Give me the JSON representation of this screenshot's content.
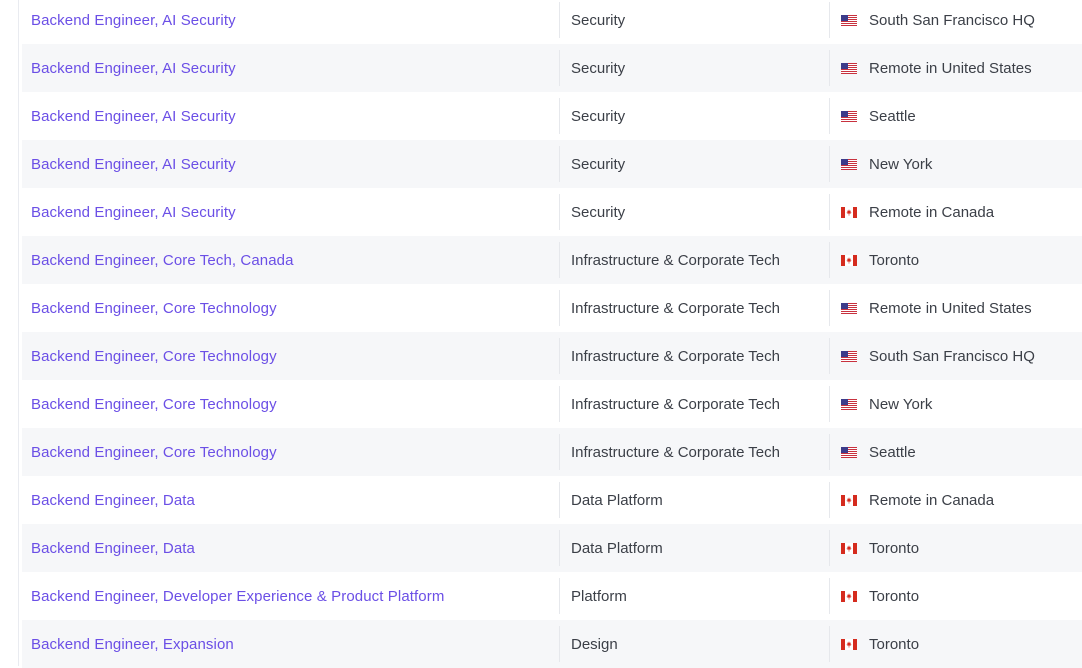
{
  "jobs": [
    {
      "title": "Backend Engineer, AI Security",
      "team": "Security",
      "location": "South San Francisco HQ",
      "flag": "us-flag-icon"
    },
    {
      "title": "Backend Engineer, AI Security",
      "team": "Security",
      "location": "Remote in United States",
      "flag": "us-flag-icon"
    },
    {
      "title": "Backend Engineer, AI Security",
      "team": "Security",
      "location": "Seattle",
      "flag": "us-flag-icon"
    },
    {
      "title": "Backend Engineer, AI Security",
      "team": "Security",
      "location": "New York",
      "flag": "us-flag-icon"
    },
    {
      "title": "Backend Engineer, AI Security",
      "team": "Security",
      "location": "Remote in Canada",
      "flag": "canada-flag-icon"
    },
    {
      "title": "Backend Engineer, Core Tech, Canada",
      "team": "Infrastructure & Corporate Tech",
      "location": "Toronto",
      "flag": "canada-flag-icon"
    },
    {
      "title": "Backend Engineer, Core Technology",
      "team": "Infrastructure & Corporate Tech",
      "location": "Remote in United States",
      "flag": "us-flag-icon"
    },
    {
      "title": "Backend Engineer, Core Technology",
      "team": "Infrastructure & Corporate Tech",
      "location": "South San Francisco HQ",
      "flag": "us-flag-icon"
    },
    {
      "title": "Backend Engineer, Core Technology",
      "team": "Infrastructure & Corporate Tech",
      "location": "New York",
      "flag": "us-flag-icon"
    },
    {
      "title": "Backend Engineer, Core Technology",
      "team": "Infrastructure & Corporate Tech",
      "location": "Seattle",
      "flag": "us-flag-icon"
    },
    {
      "title": "Backend Engineer, Data",
      "team": "Data Platform",
      "location": "Remote in Canada",
      "flag": "canada-flag-icon"
    },
    {
      "title": "Backend Engineer, Data",
      "team": "Data Platform",
      "location": "Toronto",
      "flag": "canada-flag-icon"
    },
    {
      "title": "Backend Engineer, Developer Experience & Product Platform",
      "team": "Platform",
      "location": "Toronto",
      "flag": "canada-flag-icon"
    },
    {
      "title": "Backend Engineer, Expansion",
      "team": "Design",
      "location": "Toronto",
      "flag": "canada-flag-icon"
    }
  ],
  "colors": {
    "link": "#6b4fe6",
    "text": "#3b3f47",
    "row_alt": "#f6f7f9"
  }
}
